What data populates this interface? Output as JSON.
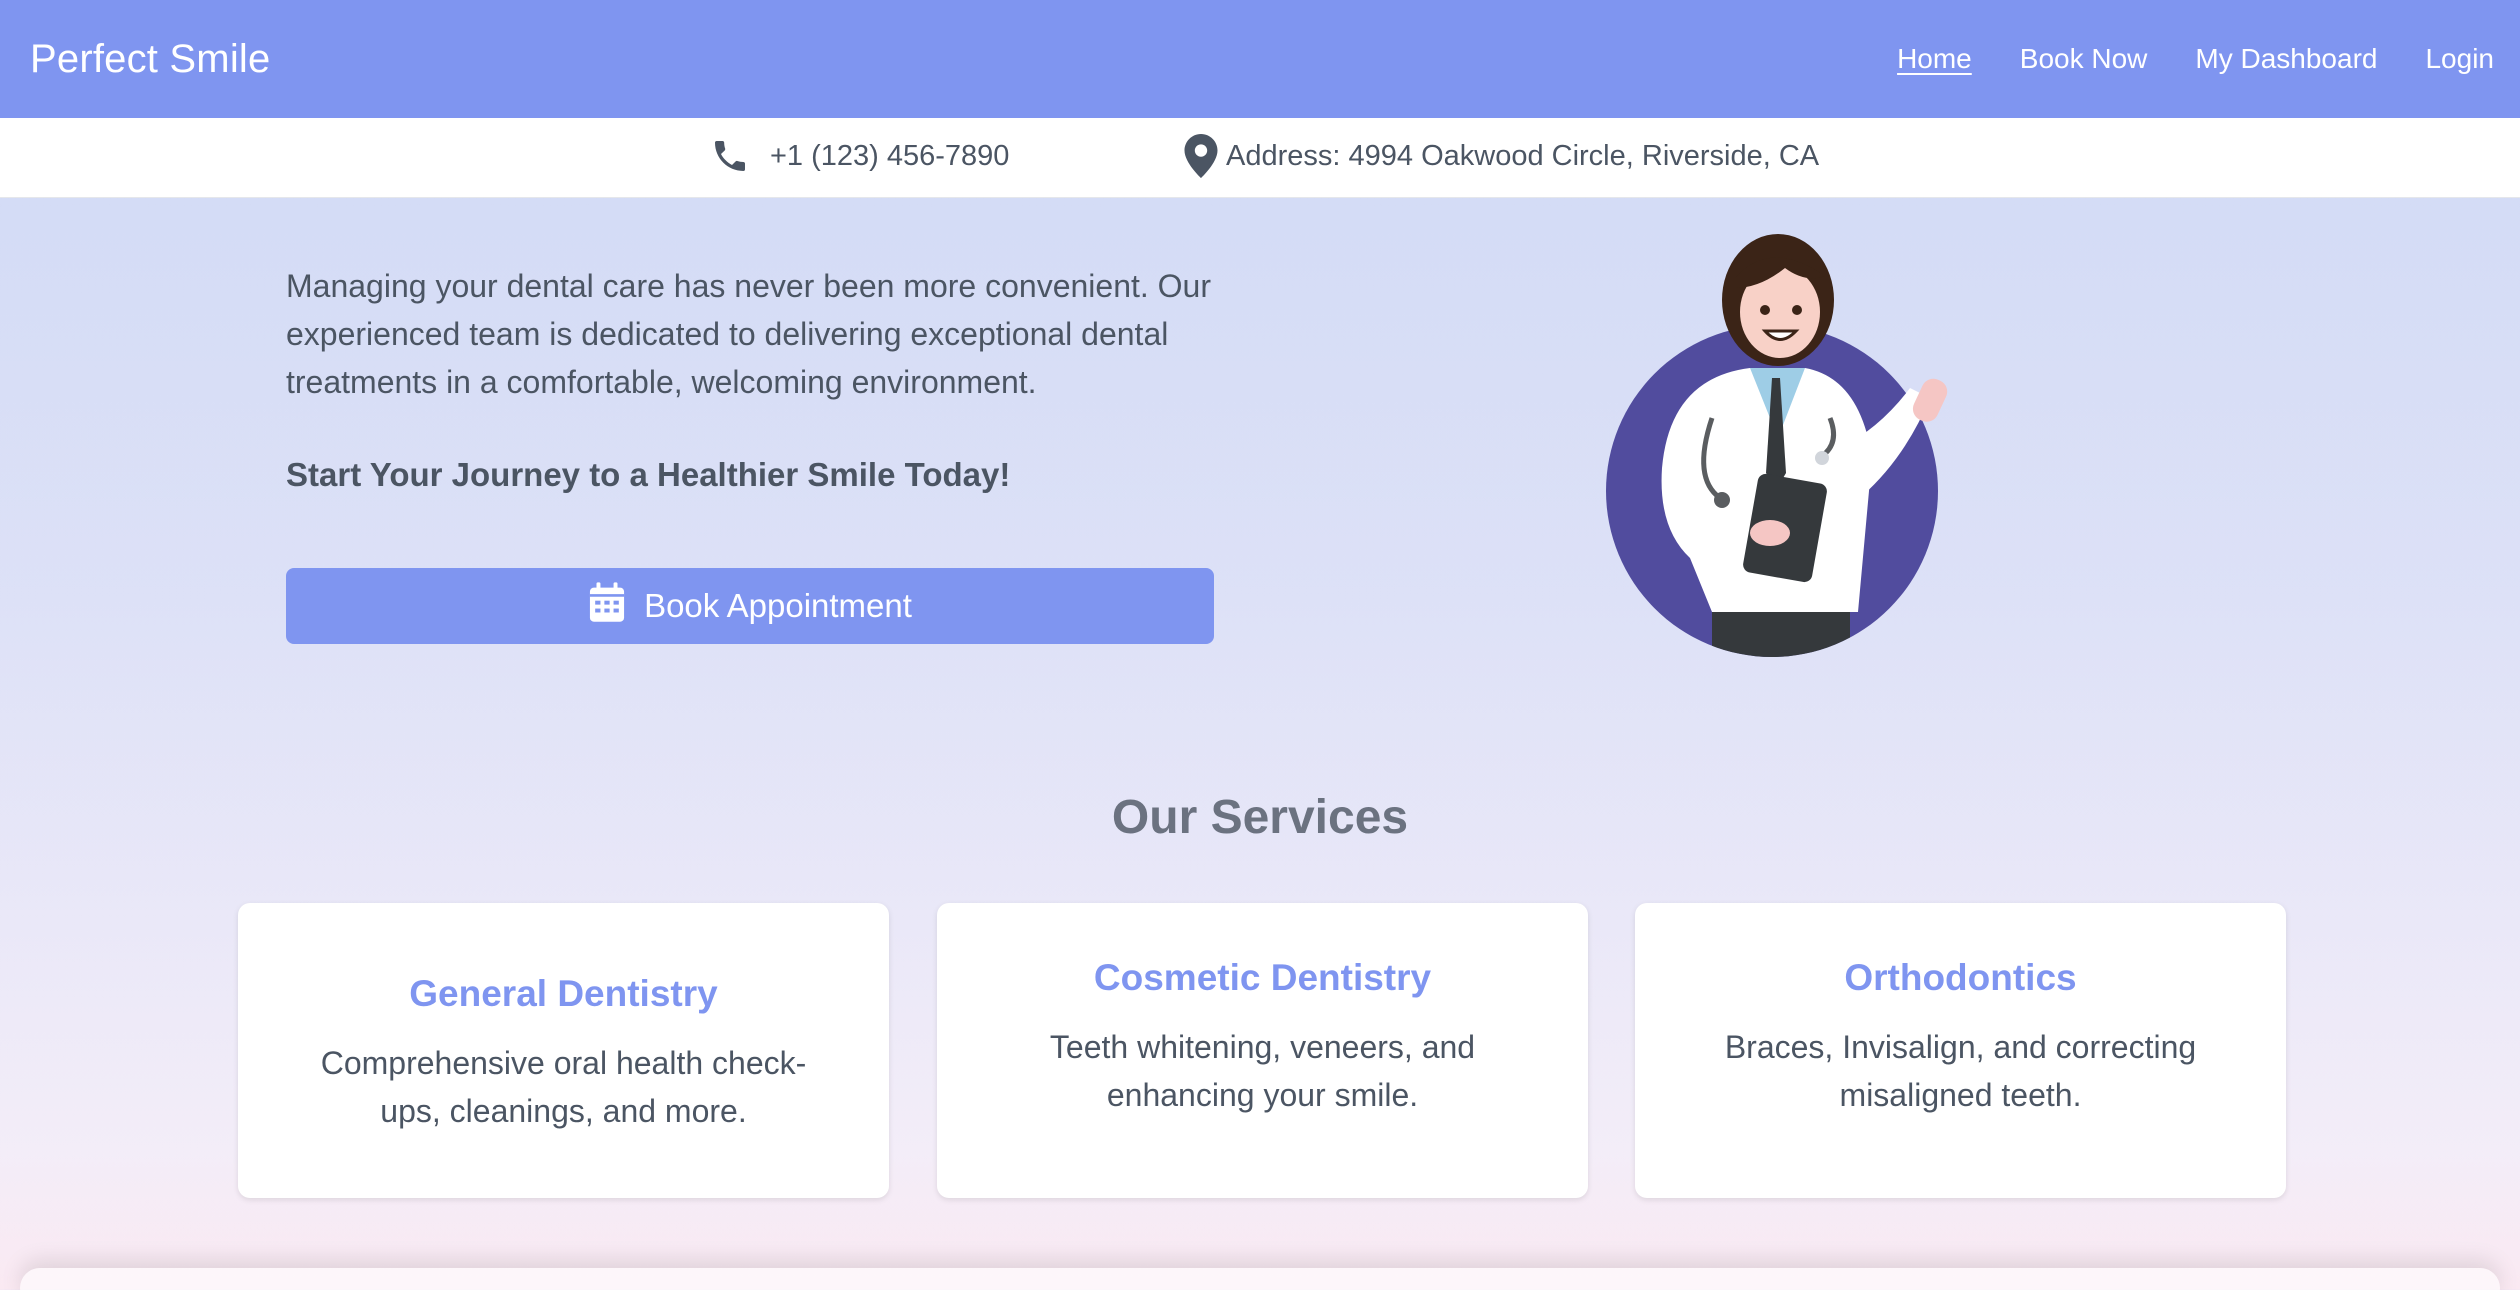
{
  "nav": {
    "brand": "Perfect Smile",
    "links": [
      "Home",
      "Book Now",
      "My Dashboard",
      "Login"
    ],
    "active": "Home",
    "color": "#7f95f0"
  },
  "info": {
    "phone": "+1 (123) 456-7890",
    "address": "Address: 4994 Oakwood Circle, Riverside, CA"
  },
  "hero": {
    "paragraph": "Managing your dental care has never been more convenient. Our experienced team is dedicated to delivering exceptional dental treatments in a comfortable, welcoming environment.",
    "cta_text": "Start Your Journey to a Healthier Smile Today!",
    "button_label": "Book Appointment",
    "illustration": "doctor-illustration"
  },
  "services": {
    "title": "Our Services",
    "items": [
      {
        "title": "General Dentistry",
        "description": "Comprehensive oral health check-ups, cleanings, and more."
      },
      {
        "title": "Cosmetic Dentistry",
        "description": "Teeth whitening, veneers, and enhancing your smile."
      },
      {
        "title": "Orthodontics",
        "description": "Braces, Invisalign, and correcting misaligned teeth."
      }
    ]
  },
  "icons": [
    "phone-icon",
    "location-pin-icon",
    "calendar-icon"
  ]
}
